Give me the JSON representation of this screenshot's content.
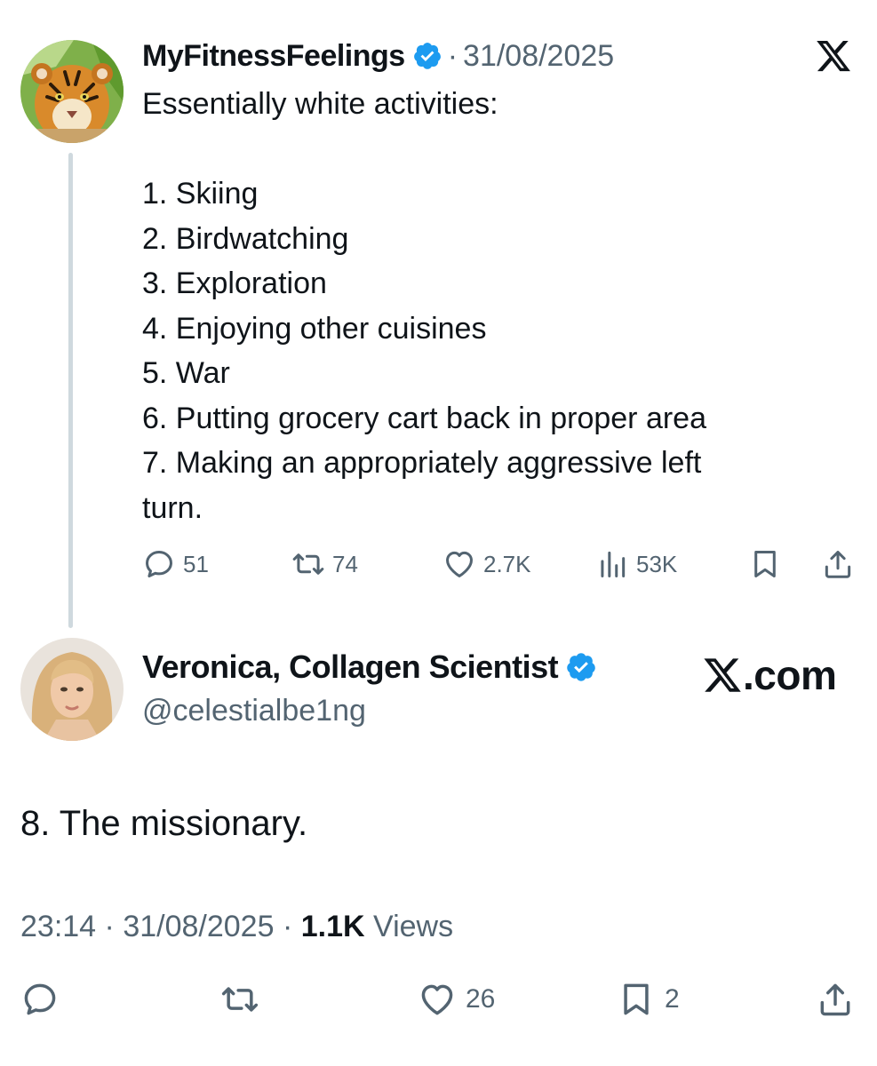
{
  "tweet1": {
    "author_name": "MyFitnessFeelings",
    "separator": "·",
    "date": "31/08/2025",
    "avatar_icon": "tiger-avatar",
    "lines": [
      "Essentially white activities:",
      "",
      "1. Skiing",
      "2. Birdwatching",
      "3. Exploration",
      "4. Enjoying other cuisines",
      "5. War",
      "6. Putting grocery cart back in proper area",
      "7. Making an appropriately aggressive left",
      "turn."
    ],
    "actions": {
      "replies": "51",
      "retweets": "74",
      "likes": "2.7K",
      "views": "53K"
    }
  },
  "tweet2": {
    "author_name": "Veronica, Collagen Scientist",
    "handle": "@celestialbe1ng",
    "avatar_icon": "woman-avatar",
    "text": "8. The missionary.",
    "time": "23:14",
    "separator": "·",
    "date": "31/08/2025",
    "views_count": "1.1K",
    "views_label": "Views",
    "actions": {
      "likes": "26",
      "bookmarks": "2"
    }
  },
  "branding": {
    "watermark": ".com"
  },
  "colors": {
    "text": "#0f1419",
    "secondary": "#536471",
    "verified": "#1d9bf0",
    "thread_line": "#cfd9de"
  }
}
